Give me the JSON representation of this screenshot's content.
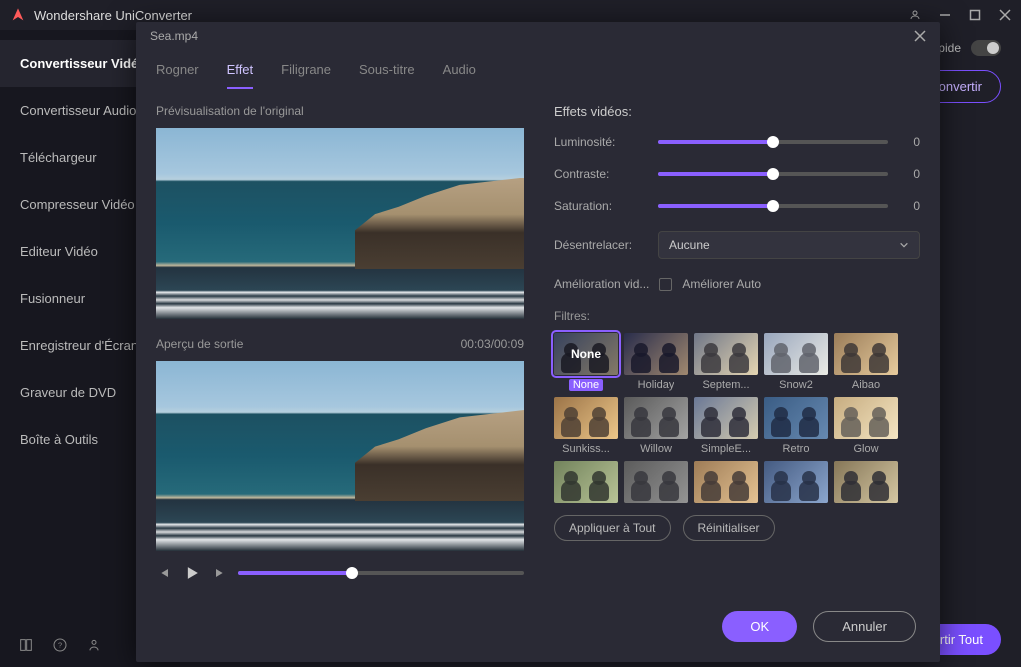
{
  "app": {
    "title": "Wondershare UniConverter"
  },
  "window": {
    "fast_label": "rapide"
  },
  "sidebar": {
    "items": [
      {
        "label": "Convertisseur Vidéo"
      },
      {
        "label": "Convertisseur Audio"
      },
      {
        "label": "Téléchargeur"
      },
      {
        "label": "Compresseur Vidéo"
      },
      {
        "label": "Editeur Vidéo"
      },
      {
        "label": "Fusionneur"
      },
      {
        "label": "Enregistreur d'Écran"
      },
      {
        "label": "Graveur de DVD"
      },
      {
        "label": "Boîte à Outils"
      }
    ]
  },
  "content": {
    "convert_label": "Convertir",
    "convert_all_label": "Convertir Tout"
  },
  "modal": {
    "filename": "Sea.mp4",
    "tabs": {
      "rogner": "Rogner",
      "effet": "Effet",
      "filigrane": "Filigrane",
      "soustitre": "Sous-titre",
      "audio": "Audio"
    },
    "preview": {
      "original_label": "Prévisualisation de l'original",
      "output_label": "Aperçu de sortie",
      "time": "00:03/00:09"
    },
    "effects": {
      "title": "Effets vidéos:",
      "brightness_label": "Luminosité:",
      "brightness_value": "0",
      "contrast_label": "Contraste:",
      "contrast_value": "0",
      "saturation_label": "Saturation:",
      "saturation_value": "0",
      "deinterlace_label": "Désentrelacer:",
      "deinterlace_value": "Aucune",
      "enhance_label": "Amélioration vid...",
      "enhance_auto": "Améliorer Auto",
      "filters_label": "Filtres:"
    },
    "filters": [
      {
        "name": "None",
        "bg": "linear-gradient(135deg,#4a5f8a,#d8c49a)",
        "tint": ""
      },
      {
        "name": "Holiday",
        "bg": "linear-gradient(135deg,#2a2f4a,#c9a97a)",
        "tint": "rgba(40,40,80,0.25)"
      },
      {
        "name": "Septem...",
        "bg": "linear-gradient(135deg,#55607a,#e8d7b0)",
        "tint": "rgba(220,210,190,0.2)"
      },
      {
        "name": "Snow2",
        "bg": "linear-gradient(135deg,#6a7a9a,#e8e4d8)",
        "tint": "rgba(240,250,255,0.35)"
      },
      {
        "name": "Aibao",
        "bg": "linear-gradient(135deg,#886a4a,#e8cda0)",
        "tint": "rgba(230,200,150,0.2)"
      },
      {
        "name": "Sunkiss...",
        "bg": "linear-gradient(135deg,#7a5838,#e8c890)",
        "tint": "rgba(255,200,120,0.25)"
      },
      {
        "name": "Willow",
        "bg": "linear-gradient(135deg,#4a4a4a,#bababa)",
        "tint": "rgba(120,120,120,0.35)"
      },
      {
        "name": "SimpleE...",
        "bg": "linear-gradient(135deg,#5a6a8a,#d8cda8)",
        "tint": "rgba(200,200,220,0.15)"
      },
      {
        "name": "Retro",
        "bg": "linear-gradient(135deg,#3a5a7a,#7a9ab8)",
        "tint": "rgba(60,100,160,0.3)"
      },
      {
        "name": "Glow",
        "bg": "linear-gradient(135deg,#a8885a,#f0e0c0)",
        "tint": "rgba(255,240,200,0.35)"
      },
      {
        "name": "",
        "bg": "linear-gradient(135deg,#6a7a5a,#c8d0a8)",
        "tint": "rgba(140,160,100,0.25)"
      },
      {
        "name": "",
        "bg": "linear-gradient(135deg,#555,#bbb)",
        "tint": "rgba(100,100,100,0.45)"
      },
      {
        "name": "",
        "bg": "linear-gradient(135deg,#8a6a48,#e8c898)",
        "tint": "rgba(220,180,130,0.25)"
      },
      {
        "name": "",
        "bg": "linear-gradient(135deg,#3a4a6a,#9ab0d0)",
        "tint": "rgba(100,140,200,0.25)"
      },
      {
        "name": "",
        "bg": "linear-gradient(135deg,#7a6848,#d8c8a0)",
        "tint": "rgba(200,200,180,0.15)"
      }
    ],
    "actions": {
      "apply_all": "Appliquer à Tout",
      "reset": "Réinitialiser",
      "ok": "OK",
      "cancel": "Annuler"
    }
  }
}
